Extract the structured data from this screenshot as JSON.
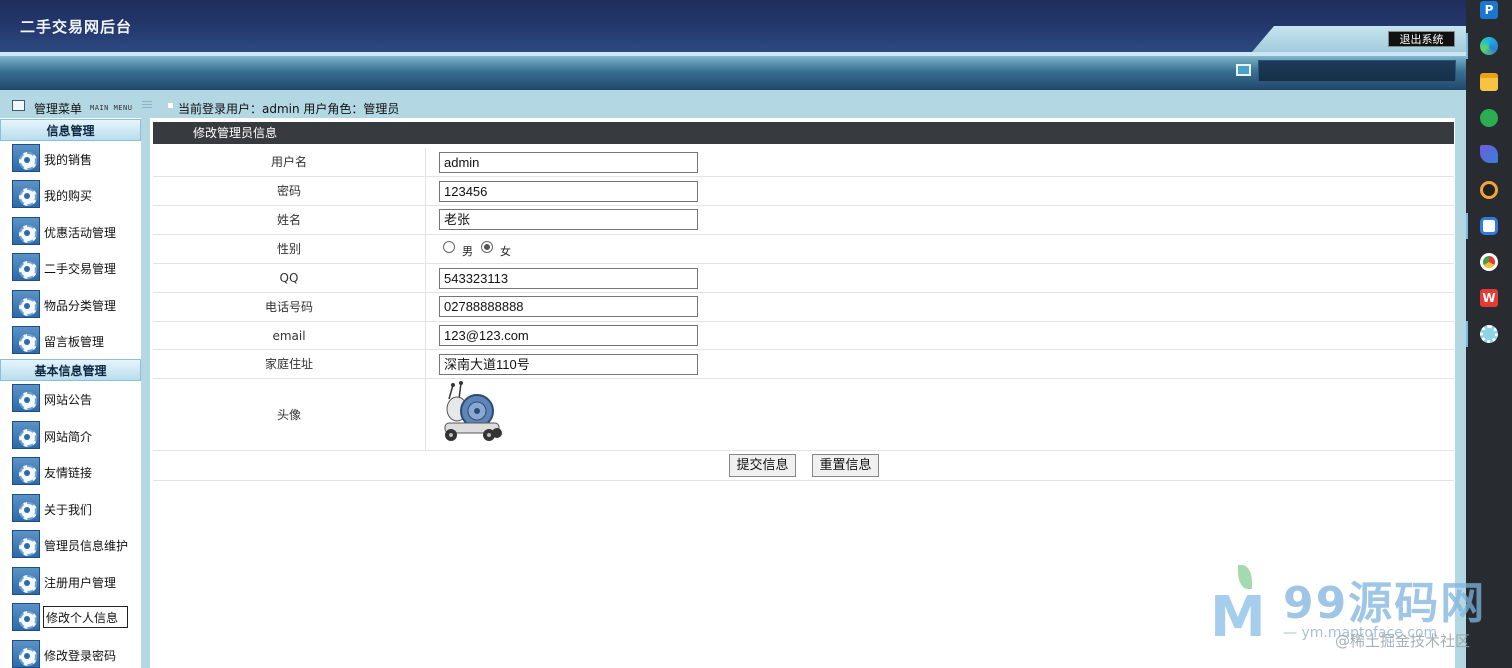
{
  "header": {
    "site_title": "二手交易网后台",
    "logout_label": "退出系统"
  },
  "menu": {
    "title": "管理菜单",
    "subtitle": "MAIN MENU",
    "sections": [
      {
        "title": "信息管理",
        "items": [
          "我的销售",
          "我的购买",
          "优惠活动管理",
          "二手交易管理",
          "物品分类管理",
          "留言板管理"
        ]
      },
      {
        "title": "基本信息管理",
        "items": [
          "网站公告",
          "网站简介",
          "友情链接",
          "关于我们",
          "管理员信息维护",
          "注册用户管理",
          "修改个人信息",
          "修改登录密码"
        ]
      }
    ],
    "active_item": "修改个人信息"
  },
  "status": {
    "user_info": "当前登录用户：admin  用户角色：管理员"
  },
  "form": {
    "title": "修改管理员信息",
    "username_label": "用户名",
    "username_value": "admin",
    "password_label": "密码",
    "password_value": "123456",
    "name_label": "姓名",
    "name_value": "老张",
    "gender_label": "性别",
    "gender_options": [
      "男",
      "女"
    ],
    "gender_selected": "女",
    "qq_label": "QQ",
    "qq_value": "543323113",
    "phone_label": "电话号码",
    "phone_value": "02788888888",
    "email_label": "email",
    "email_value": "123@123.com",
    "address_label": "家庭住址",
    "address_value": "深南大道110号",
    "avatar_label": "头像",
    "submit_label": "提交信息",
    "reset_label": "重置信息"
  },
  "taskbar": {
    "icons": [
      "p-app-icon",
      "edge-icon",
      "file-explorer-icon",
      "wechat-icon",
      "app-s-icon",
      "settings-gear-icon",
      "baidu-netdisk-icon",
      "chrome-icon",
      "wps-icon",
      "flower-app-icon"
    ]
  },
  "watermark": {
    "big": "99源码网",
    "small": "— ym.maptoface.com",
    "credit": "@稀土掘金技术社区"
  },
  "colors": {
    "header_bg": "#23366b",
    "panel_bg": "#b3d8e3",
    "content_head_bg": "#373b40",
    "taskbar_bg": "#282c31"
  }
}
